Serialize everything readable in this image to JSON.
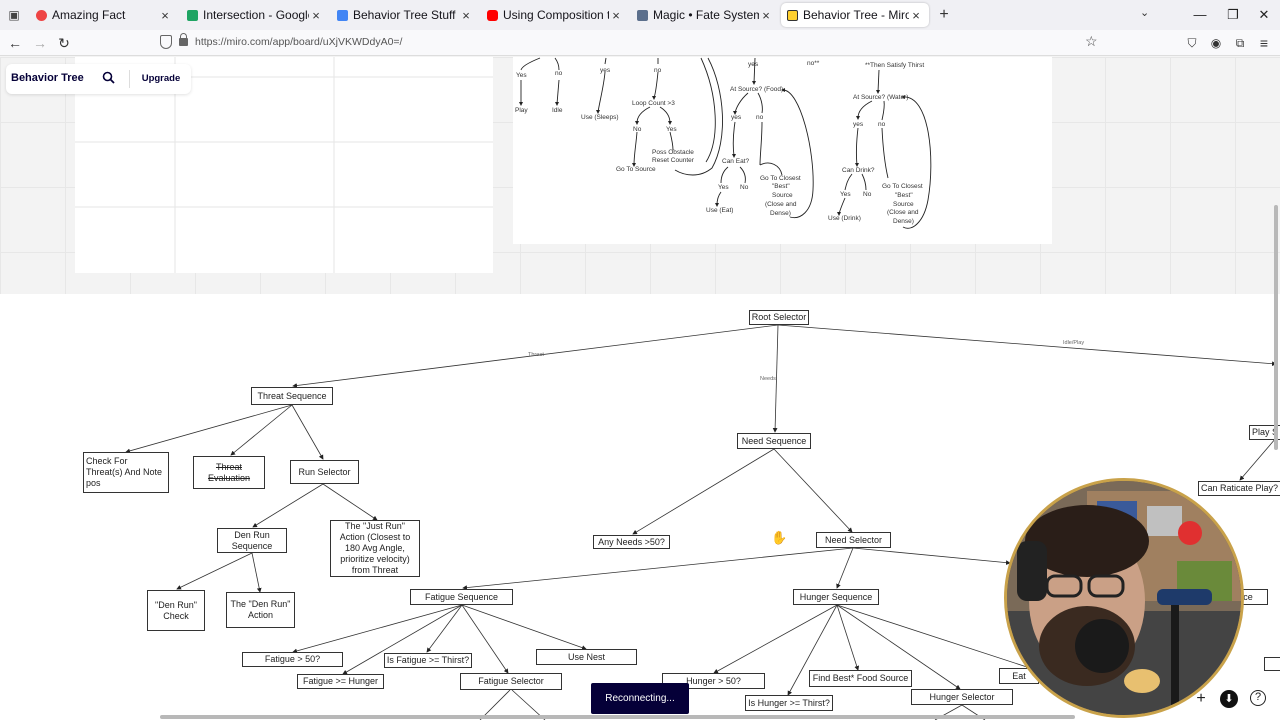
{
  "browser": {
    "tabs": [
      {
        "title": "Amazing Fact",
        "color": "#e44"
      },
      {
        "title": "Intersection - Google Sheets",
        "color": "#1fa463"
      },
      {
        "title": "Behavior Tree Stuff - Google Do",
        "color": "#4285f4"
      },
      {
        "title": "Using Composition to Make Mo",
        "color": "#ff0000"
      },
      {
        "title": "Magic • Fate System Toolkit",
        "color": "#5b6f8c"
      },
      {
        "title": "Behavior Tree - Miro",
        "color": "#ffd02f"
      }
    ],
    "url": "https://miro.com/app/board/uXjVKWDdyA0=/"
  },
  "miro": {
    "board_name": "Behavior Tree",
    "upgrade_label": "Upgrade"
  },
  "sketch": {
    "labels": [
      "Yes",
      "no",
      "yes",
      "no",
      "Play",
      "Idle",
      "Use (Sleeps)",
      "Loop Count >3",
      "No",
      "Yes",
      "Poss Obstacle",
      "Reset Counter",
      "Go To Source",
      "yes",
      "no**",
      "**Then Satisfy Thirst",
      "At Source? (Food)",
      "yes",
      "no",
      "Can Eat?",
      "Yes",
      "No",
      "Use (Eat)",
      "Go To Closest",
      "\"Best\"",
      "Source",
      "(Close and",
      "Dense)",
      "At Source? (Water)",
      "yes",
      "no",
      "Can Drink?",
      "Yes",
      "No",
      "Use (Drink)",
      "Go To Closest",
      "\"Best\"",
      "Source",
      "(Close and",
      "Dense)"
    ]
  },
  "tree": {
    "edge_labels": {
      "threat": "Threat",
      "needs": "Needs",
      "idle": "Idle/Play"
    },
    "nodes": {
      "root": "Root Selector",
      "threat_seq": "Threat Sequence",
      "check_threat": "Check For Threat(s) And Note pos",
      "threat_eval": "Threat Evaluation",
      "run_selector": "Run Selector",
      "den_run_seq": "Den Run Sequence",
      "just_run": "The \"Just Run\" Action (Closest to 180 Avg Angle, prioritize velocity) from Threat",
      "den_run_check": "\"Den Run\" Check",
      "den_run_action": "The \"Den Run\" Action",
      "need_seq": "Need Sequence",
      "any_needs": "Any Needs >50?",
      "need_selector": "Need Selector",
      "fatigue_seq": "Fatigue Sequence",
      "hunger_seq": "Hunger Sequence",
      "fatigue_50": "Fatigue > 50?",
      "fatigue_hunger": "Fatigue >= Hunger",
      "fatigue_thirst": "Is Fatigue >= Thirst?",
      "fatigue_selector": "Fatigue Selector",
      "use_nest": "Use Nest",
      "hunger_50": "Hunger > 50?",
      "hunger_thirst": "Is Hunger >= Thirst?",
      "find_food": "Find Best* Food Source",
      "hunger_selector": "Hunger Selector",
      "eat_partial": "Eat",
      "play_partial": "Play S",
      "can_ratticate": "Can Raticate Play?",
      "partial_ce": "ce"
    }
  },
  "status": {
    "toast": "Reconnecting..."
  }
}
